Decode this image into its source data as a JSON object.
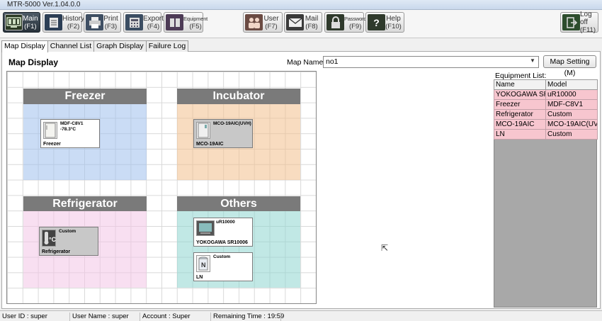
{
  "window": {
    "title": "MTR-5000 Ver.1.04.0.0"
  },
  "toolbar": {
    "buttons": [
      {
        "label": "Main",
        "key": "(F1)",
        "icon": "monitor-icon"
      },
      {
        "label": "History",
        "key": "(F2)",
        "icon": "history-book-icon"
      },
      {
        "label": "Print",
        "key": "(F3)",
        "icon": "printer-icon"
      },
      {
        "label": "Export",
        "key": "(F4)",
        "icon": "export-calculator-icon"
      },
      {
        "label": "Equipment",
        "key": "(F5)",
        "icon": "equipment-icon"
      },
      {
        "label": "User",
        "key": "(F7)",
        "icon": "users-icon"
      },
      {
        "label": "Mail",
        "key": "(F8)",
        "icon": "mail-icon"
      },
      {
        "label": "Password",
        "key": "(F9)",
        "icon": "lock-icon"
      },
      {
        "label": "Help",
        "key": "(F10)",
        "icon": "help-icon"
      },
      {
        "label": "Log off",
        "key": "(F11)",
        "icon": "logoff-icon"
      }
    ]
  },
  "tabs": [
    "Map Display",
    "Channel List",
    "Graph Display",
    "Failure Log"
  ],
  "main": {
    "title": "Map Display",
    "map_name_label": "Map Name:",
    "map_name_value": "no1",
    "map_setting_label": "Map Setting (M)"
  },
  "map": {
    "zones": [
      {
        "name": "Freezer",
        "color": "#9ec0ec"
      },
      {
        "name": "Incubator",
        "color": "#f2c08c"
      },
      {
        "name": "Refrigerator",
        "color": "#f2c4e6"
      },
      {
        "name": "Others",
        "color": "#8ed6cf"
      }
    ],
    "devices": [
      {
        "line1": "MDF-C8V1",
        "line2": "-78.3°C",
        "name": "Freezer",
        "icon": "freezer-icon"
      },
      {
        "line1": "MCO-19AIC(UVH)",
        "line2": "",
        "name": "MCO-19AIC",
        "icon": "incubator-icon"
      },
      {
        "line1": "Custom",
        "line2": "",
        "name": "Refrigerator",
        "icon": "thermometer-celsius-icon",
        "badge": "°C"
      },
      {
        "line1": "uR10000",
        "line2": "",
        "name": "YOKOGAWA SR10006",
        "icon": "recorder-icon"
      },
      {
        "line1": "Custom",
        "line2": "",
        "name": "LN",
        "icon": "ln-tank-icon",
        "badge": "N"
      }
    ]
  },
  "equipment": {
    "label": "Equipment List:",
    "columns": [
      "Name",
      "Model"
    ],
    "rows": [
      {
        "name": "YOKOGAWA SR",
        "model": "uR10000"
      },
      {
        "name": "Freezer",
        "model": "MDF-C8V1"
      },
      {
        "name": "Refrigerator",
        "model": "Custom"
      },
      {
        "name": "MCO-19AIC",
        "model": "MCO-19AIC(UVH"
      },
      {
        "name": "LN",
        "model": "Custom"
      }
    ]
  },
  "status": {
    "user_id": "User ID : super",
    "user_name": "User Name : super",
    "account": "Account : Super",
    "remaining": "Remaining Time : 19:59"
  }
}
